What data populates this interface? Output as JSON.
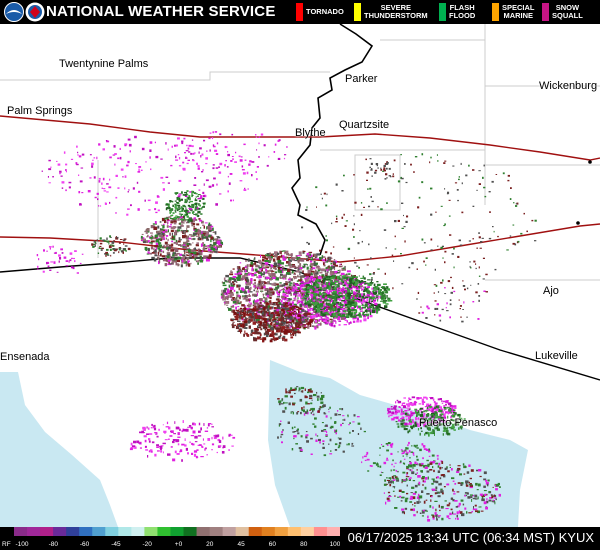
{
  "header": {
    "title": "NATIONAL WEATHER SERVICE",
    "logos": [
      "noaa-logo",
      "nws-logo"
    ],
    "legend": [
      {
        "label": "TORNADO",
        "color": "#ff0000"
      },
      {
        "label": "SEVERE\nTHUNDERSTORM",
        "color": "#ffff00"
      },
      {
        "label": "FLASH\nFLOOD",
        "color": "#00b050"
      },
      {
        "label": "SPECIAL\nMARINE",
        "color": "#ffa500"
      },
      {
        "label": "SNOW\nSQUALL",
        "color": "#c71585"
      }
    ]
  },
  "places": {
    "twentynine_palms": "Twentynine Palms",
    "palm_springs": "Palm Springs",
    "parker": "Parker",
    "wickenburg": "Wickenburg",
    "blythe": "Blythe",
    "quartzsite": "Quartzsite",
    "ajo": "Ajo",
    "ensenada": "Ensenada",
    "lukeville": "Lukeville",
    "puerto_penasco": "Puerto Penasco"
  },
  "scale": {
    "prefix": "RF",
    "ticks": [
      "-100",
      "-80",
      "-60",
      "-45",
      "-20",
      "+0",
      "20",
      "45",
      "60",
      "80",
      "100"
    ]
  },
  "status": {
    "timestamp": "06/17/2025 13:34 UTC (06:34 MST) KYUX"
  },
  "colors": {
    "water": "#c9e8f2",
    "roads": "#a01010",
    "borders": "#000000",
    "county_lines": "#cccccc"
  }
}
